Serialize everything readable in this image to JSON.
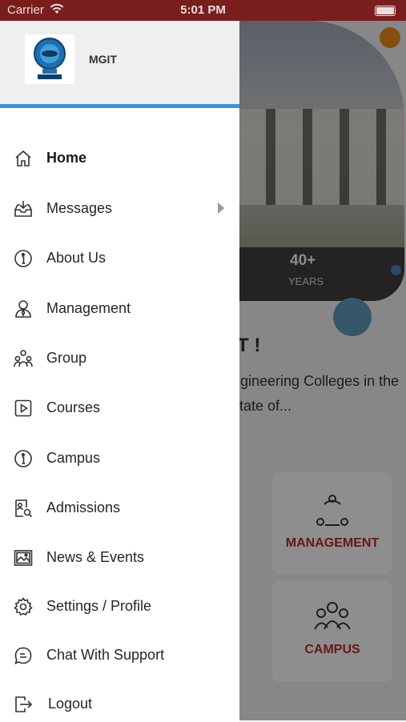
{
  "status_bar": {
    "carrier": "Carrier",
    "time": "5:01 PM"
  },
  "drawer": {
    "app_name": "MGIT",
    "items": [
      {
        "label": "Home",
        "icon": "home-icon",
        "active": true
      },
      {
        "label": "Messages",
        "icon": "inbox-download-icon",
        "has_submenu": true
      },
      {
        "label": "About Us",
        "icon": "info-icon"
      },
      {
        "label": "Management",
        "icon": "user-tie-icon"
      },
      {
        "label": "Group",
        "icon": "group-icon"
      },
      {
        "label": "Courses",
        "icon": "play-square-icon"
      },
      {
        "label": "Campus",
        "icon": "info-icon"
      },
      {
        "label": "Admissions",
        "icon": "document-search-icon"
      },
      {
        "label": "News & Events",
        "icon": "image-frame-icon"
      },
      {
        "label": "Settings / Profile",
        "icon": "gear-icon"
      },
      {
        "label": "Chat With Support",
        "icon": "chat-icon"
      },
      {
        "label": "Logout",
        "icon": "logout-icon"
      }
    ]
  },
  "background": {
    "stat_value": "40+",
    "stat_label": "YEARS",
    "title_fragment": "T !",
    "description_fragment": "ngineering Colleges in the state of...",
    "cards": [
      {
        "label": "MANAGEMENT",
        "icon": "management-cycle-icon"
      },
      {
        "label": "CAMPUS",
        "icon": "people-group-icon"
      }
    ]
  },
  "colors": {
    "status_bar": "#7a1d1d",
    "accent": "#3a94d8",
    "card_label": "#b32a2a"
  }
}
